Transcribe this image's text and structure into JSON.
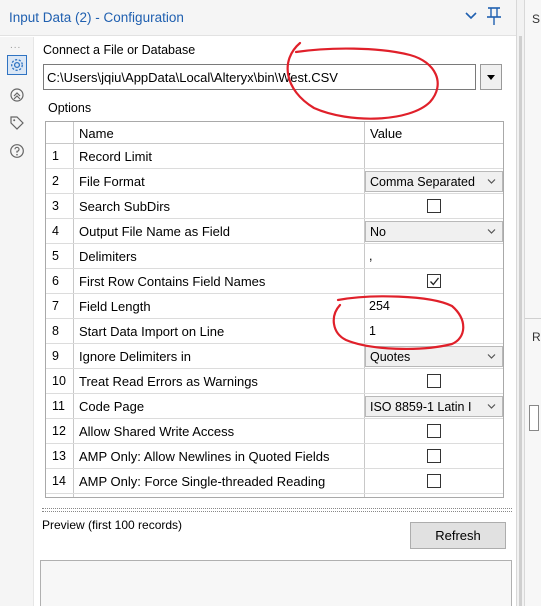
{
  "header": {
    "title": "Input Data (2) - Configuration",
    "collapse_icon": "chevron-down-icon",
    "pin_icon": "pin-icon",
    "title_color": "#2060b0"
  },
  "sidebar": {
    "dots": "...",
    "icons": [
      "gear-icon",
      "arrow-circle-icon",
      "tag-icon",
      "help-icon"
    ]
  },
  "connection": {
    "label": "Connect a File or Database",
    "path": "C:\\Users\\jqiu\\AppData\\Local\\Alteryx\\bin\\West.CSV"
  },
  "options": {
    "label": "Options",
    "columns": {
      "name": "Name",
      "value": "Value"
    },
    "rows": [
      {
        "num": "1",
        "name": "Record Limit",
        "value": "",
        "kind": "text"
      },
      {
        "num": "2",
        "name": "File Format",
        "value": "Comma Separated",
        "kind": "select"
      },
      {
        "num": "3",
        "name": "Search SubDirs",
        "value": "",
        "kind": "checkbox",
        "checked": false
      },
      {
        "num": "4",
        "name": "Output File Name as Field",
        "value": "No",
        "kind": "select"
      },
      {
        "num": "5",
        "name": "Delimiters",
        "value": ",",
        "kind": "text"
      },
      {
        "num": "6",
        "name": "First Row Contains Field Names",
        "value": "",
        "kind": "checkbox",
        "checked": true
      },
      {
        "num": "7",
        "name": "Field Length",
        "value": "254",
        "kind": "text"
      },
      {
        "num": "8",
        "name": "Start Data Import on Line",
        "value": "1",
        "kind": "text"
      },
      {
        "num": "9",
        "name": "Ignore Delimiters in",
        "value": "Quotes",
        "kind": "select"
      },
      {
        "num": "10",
        "name": "Treat Read Errors as Warnings",
        "value": "",
        "kind": "checkbox",
        "checked": false
      },
      {
        "num": "11",
        "name": "Code Page",
        "value": "ISO 8859-1 Latin I",
        "kind": "select"
      },
      {
        "num": "12",
        "name": "Allow Shared Write Access",
        "value": "",
        "kind": "checkbox",
        "checked": false
      },
      {
        "num": "13",
        "name": "AMP Only: Allow Newlines in Quoted Fields",
        "value": "",
        "kind": "checkbox",
        "checked": false
      },
      {
        "num": "14",
        "name": "AMP Only: Force Single-threaded Reading",
        "value": "",
        "kind": "checkbox",
        "checked": false
      }
    ]
  },
  "preview": {
    "label": "Preview (first 100 records)",
    "refresh_label": "Refresh"
  },
  "right_pane": {
    "labels": [
      "S",
      "R"
    ]
  },
  "annotation_color": "#e0202a"
}
